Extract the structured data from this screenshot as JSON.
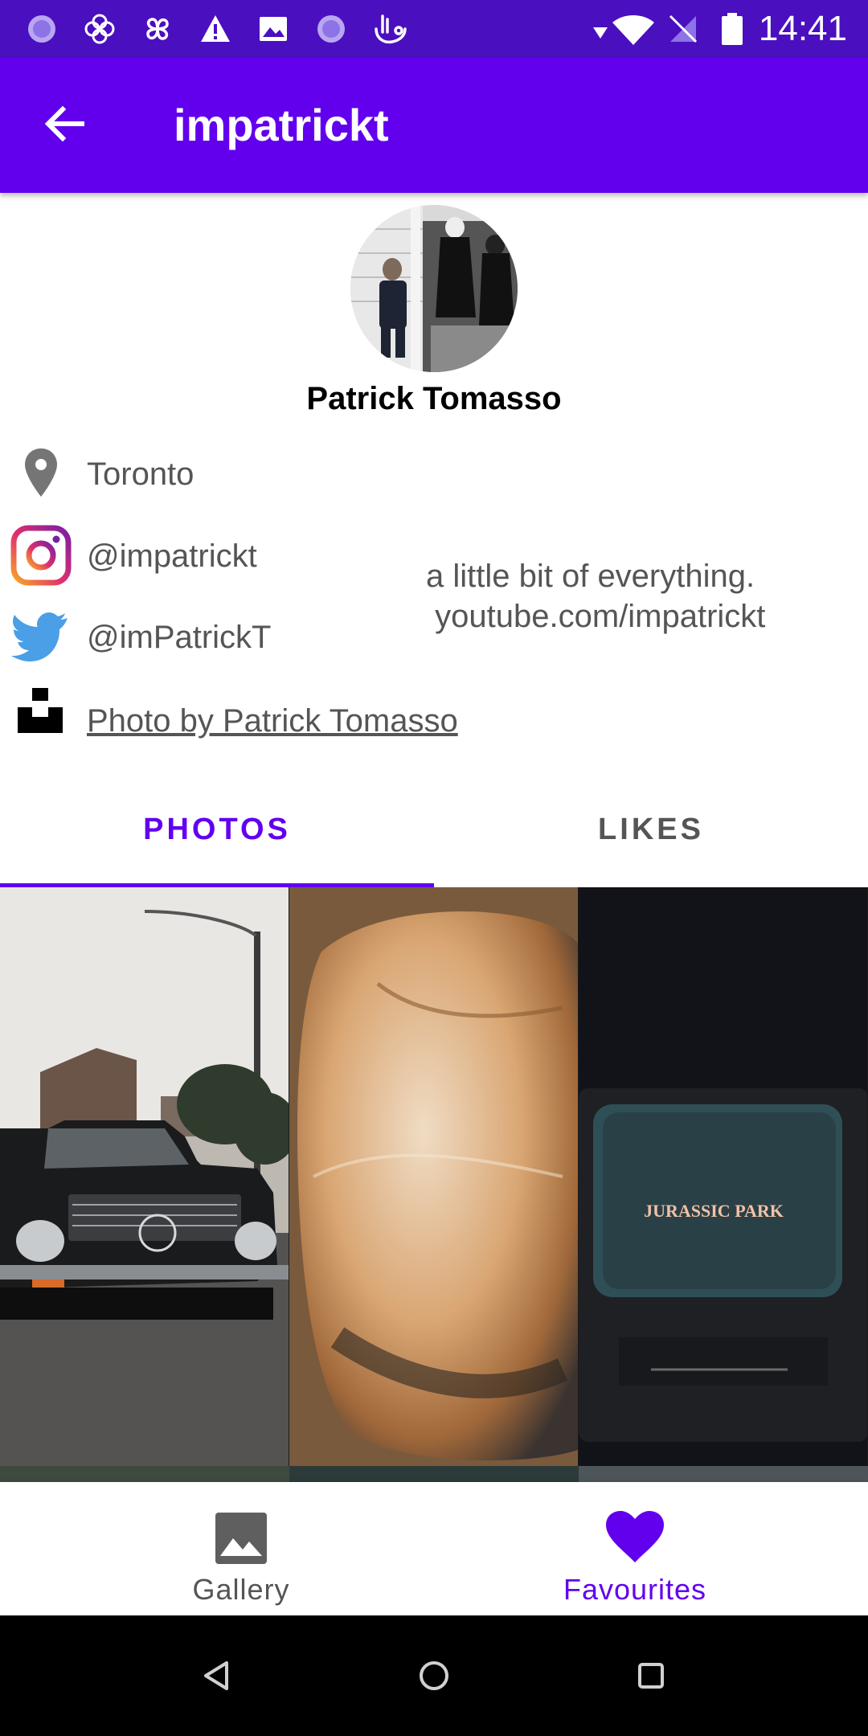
{
  "status_bar": {
    "time": "14:41",
    "icons": [
      "circle-notification-icon",
      "flower-notification-icon",
      "pinwheel-notification-icon",
      "warning-icon",
      "image-notification-icon",
      "circle-notification-icon",
      "touch-notification-icon",
      "wifi-icon",
      "signal-icon",
      "battery-icon"
    ]
  },
  "app_bar": {
    "title": "impatrickt",
    "back_icon": "arrow-back-icon"
  },
  "profile": {
    "name": "Patrick Tomasso",
    "location": "Toronto",
    "instagram": "@impatrickt",
    "twitter": "@imPatrickT",
    "unsplash_credit": "Photo by Patrick Tomasso",
    "bio": "a little bit of everything.\n youtube.com/impatrickt"
  },
  "tabs": [
    {
      "label": "PHOTOS",
      "selected": true
    },
    {
      "label": "LIKES",
      "selected": false
    }
  ],
  "photos": {
    "tv_caption": "JURASSIC PARK"
  },
  "bottom_nav": [
    {
      "label": "Gallery",
      "icon": "image-icon",
      "selected": false
    },
    {
      "label": "Favourites",
      "icon": "heart-icon",
      "selected": true
    }
  ],
  "colors": {
    "primary": "#6200ee",
    "status_bar": "#4a0fbf",
    "text_secondary": "#555555"
  }
}
